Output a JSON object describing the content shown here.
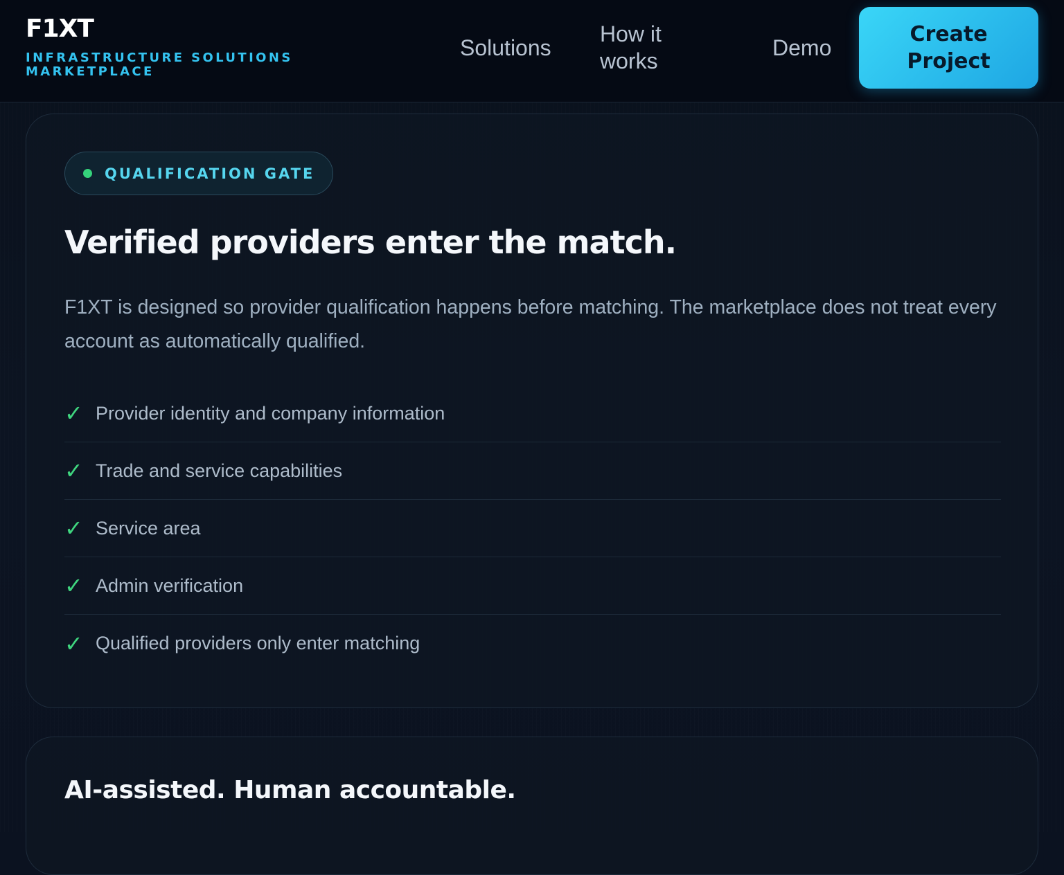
{
  "header": {
    "brand_name": "F1XT",
    "brand_tagline": "INFRASTRUCTURE SOLUTIONS MARKETPLACE",
    "nav": {
      "solutions": "Solutions",
      "how_it_works": "How it works",
      "demo": "Demo"
    },
    "cta_label": "Create Project"
  },
  "qualification_card": {
    "badge": {
      "label": "QUALIFICATION GATE",
      "dot_color": "#35d37b"
    },
    "title": "Verified providers enter the match.",
    "description": "F1XT is designed so provider qualification happens before matching. The marketplace does not treat every account as automatically qualified.",
    "check_icon": "check-icon",
    "check_color": "#3fd67f",
    "items": [
      {
        "label": "Provider identity and company information"
      },
      {
        "label": "Trade and service capabilities"
      },
      {
        "label": "Service area"
      },
      {
        "label": "Admin verification"
      },
      {
        "label": "Qualified providers only enter matching"
      }
    ]
  },
  "ai_card": {
    "title": "AI-assisted. Human accountable."
  },
  "colors": {
    "accent": "#34c3f0",
    "cta_gradient_start": "#3ad6f7",
    "cta_gradient_end": "#1ea6e3",
    "background": "#0b1220"
  }
}
